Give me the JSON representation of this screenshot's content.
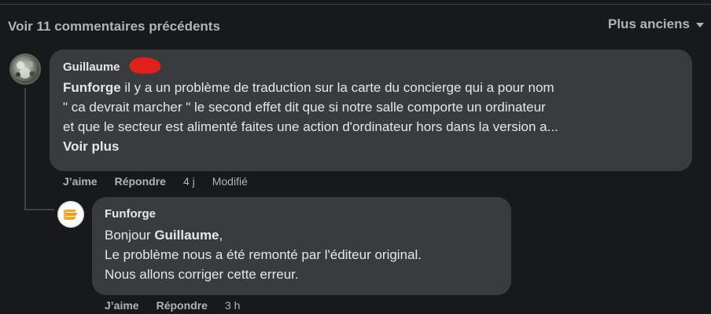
{
  "header": {
    "previous_comments_label": "Voir 11 commentaires précédents",
    "sort_label": "Plus anciens",
    "sort_icon": "caret-down-icon"
  },
  "comments": [
    {
      "author": "Guillaume",
      "author_redacted": true,
      "avatar_icon": "user-avatar",
      "mention": "Funforge",
      "text_lines": [
        " il y a un problème de traduction sur la carte du concierge qui a pour nom",
        "\" ca devrait marcher \" le second effet dit que si notre salle comporte un ordinateur",
        "et que le secteur est alimenté faites une action d'ordinateur hors dans la version a..."
      ],
      "see_more": "Voir plus",
      "actions": {
        "like": "J’aime",
        "reply": "Répondre",
        "time": "4 j",
        "edited": "Modifié"
      }
    },
    {
      "author": "Funforge",
      "avatar_icon": "funforge-logo",
      "greeting": "Bonjour ",
      "greeting_mention": "Guillaume",
      "greeting_end": ",",
      "text_lines": [
        "Le problème nous a été remonté par l'éditeur original.",
        "Nous allons corriger cette erreur."
      ],
      "actions": {
        "like": "J’aime",
        "reply": "Répondre",
        "time": "3 h"
      }
    }
  ],
  "colors": {
    "background": "#18191a",
    "bubble": "#3a3b3c",
    "text_primary": "#e4e6eb",
    "text_secondary": "#b0b3b8",
    "redaction": "#e0201b",
    "brand_orange": "#f6a623"
  }
}
